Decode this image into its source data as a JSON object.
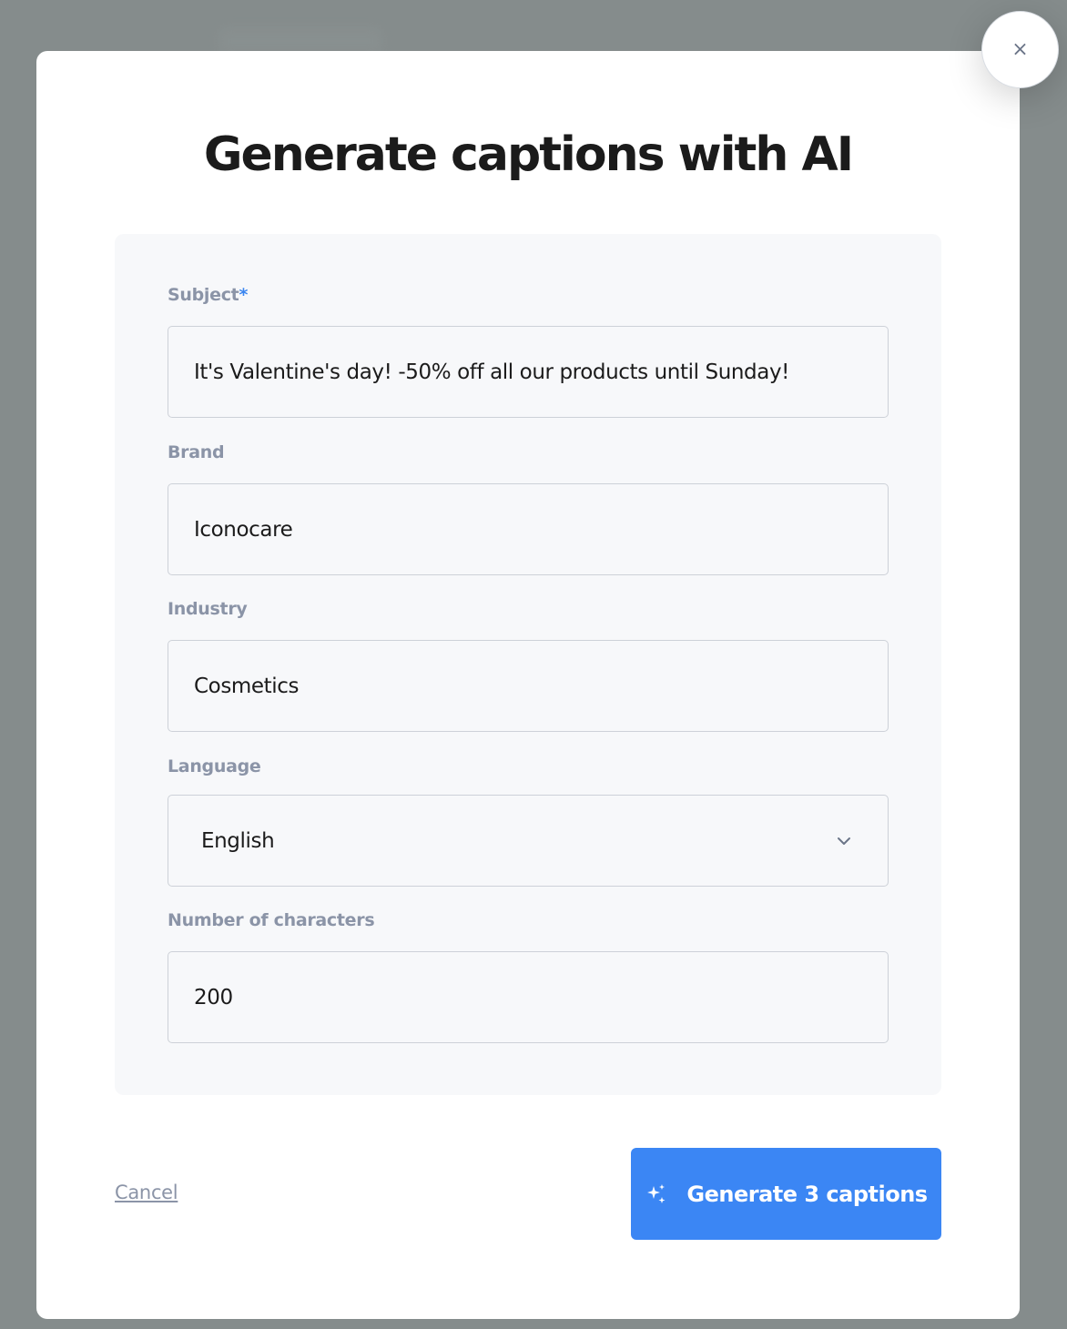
{
  "dialog": {
    "title": "Generate captions with AI",
    "close_symbol": "×"
  },
  "form": {
    "subject": {
      "label": "Subject",
      "required_mark": "*",
      "value": "It's Valentine's day! -50% off all our products until Sunday!"
    },
    "brand": {
      "label": "Brand",
      "value": "Iconocare"
    },
    "industry": {
      "label": "Industry",
      "value": "Cosmetics"
    },
    "language": {
      "label": "Language",
      "selected": "English"
    },
    "characters": {
      "label": "Number of characters",
      "value": "200"
    }
  },
  "actions": {
    "cancel_label": "Cancel",
    "generate_label": "Generate 3 captions",
    "generate_icon": "sparkles-icon"
  },
  "colors": {
    "backdrop": "#858c8c",
    "accent": "#3b86f4",
    "label": "#8b94a7",
    "panel": "#f7f8fa"
  }
}
